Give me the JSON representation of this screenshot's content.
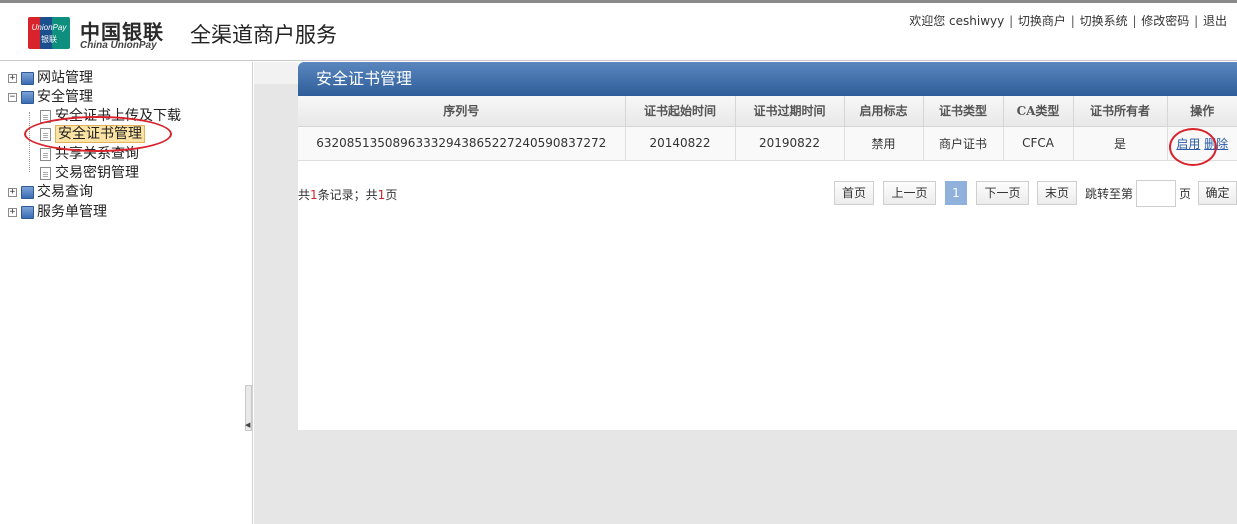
{
  "header": {
    "logo_badge_top": "UnionPay",
    "logo_badge_bottom": "银联",
    "logo_cn": "中国银联",
    "logo_en": "China UnionPay",
    "app_title": "全渠道商户服务",
    "welcome": "欢迎您 ceshiwyy",
    "links": [
      "切换商户",
      "切换系统",
      "修改密码",
      "退出"
    ]
  },
  "sidebar": {
    "nodes": [
      {
        "label": "网站管理",
        "expander": "+"
      },
      {
        "label": "安全管理",
        "expander": "−"
      },
      {
        "label": "安全证书上传及下载"
      },
      {
        "label": "安全证书管理",
        "selected": true
      },
      {
        "label": "共享关系查询"
      },
      {
        "label": "交易密钥管理"
      },
      {
        "label": "交易查询",
        "expander": "+"
      },
      {
        "label": "服务单管理",
        "expander": "+"
      }
    ]
  },
  "panel": {
    "title": "安全证书管理",
    "columns": [
      "序列号",
      "证书起始时间",
      "证书过期时间",
      "启用标志",
      "证书类型",
      "CA类型",
      "证书所有者",
      "操作"
    ],
    "rows": [
      {
        "serial": "632085135089633329438652272405908372​72",
        "start": "20140822",
        "expire": "20190822",
        "flag": "禁用",
        "cert_type": "商户证书",
        "ca_type": "CFCA",
        "owner": "是",
        "action_enable": "启用",
        "action_delete": "删除"
      }
    ]
  },
  "pager": {
    "summary_prefix": "共",
    "summary_records": "1",
    "summary_mid": "条记录；共",
    "summary_pages": "1",
    "summary_suffix": "页",
    "first": "首页",
    "prev": "上一页",
    "current": "1",
    "next": "下一页",
    "last": "末页",
    "jump_label": "跳转至第",
    "jump_unit": "页",
    "confirm": "确定"
  },
  "colors": {
    "header_bar": "#2e5d99",
    "highlight_red": "#d9232c",
    "link_blue": "#2a5ca8"
  }
}
